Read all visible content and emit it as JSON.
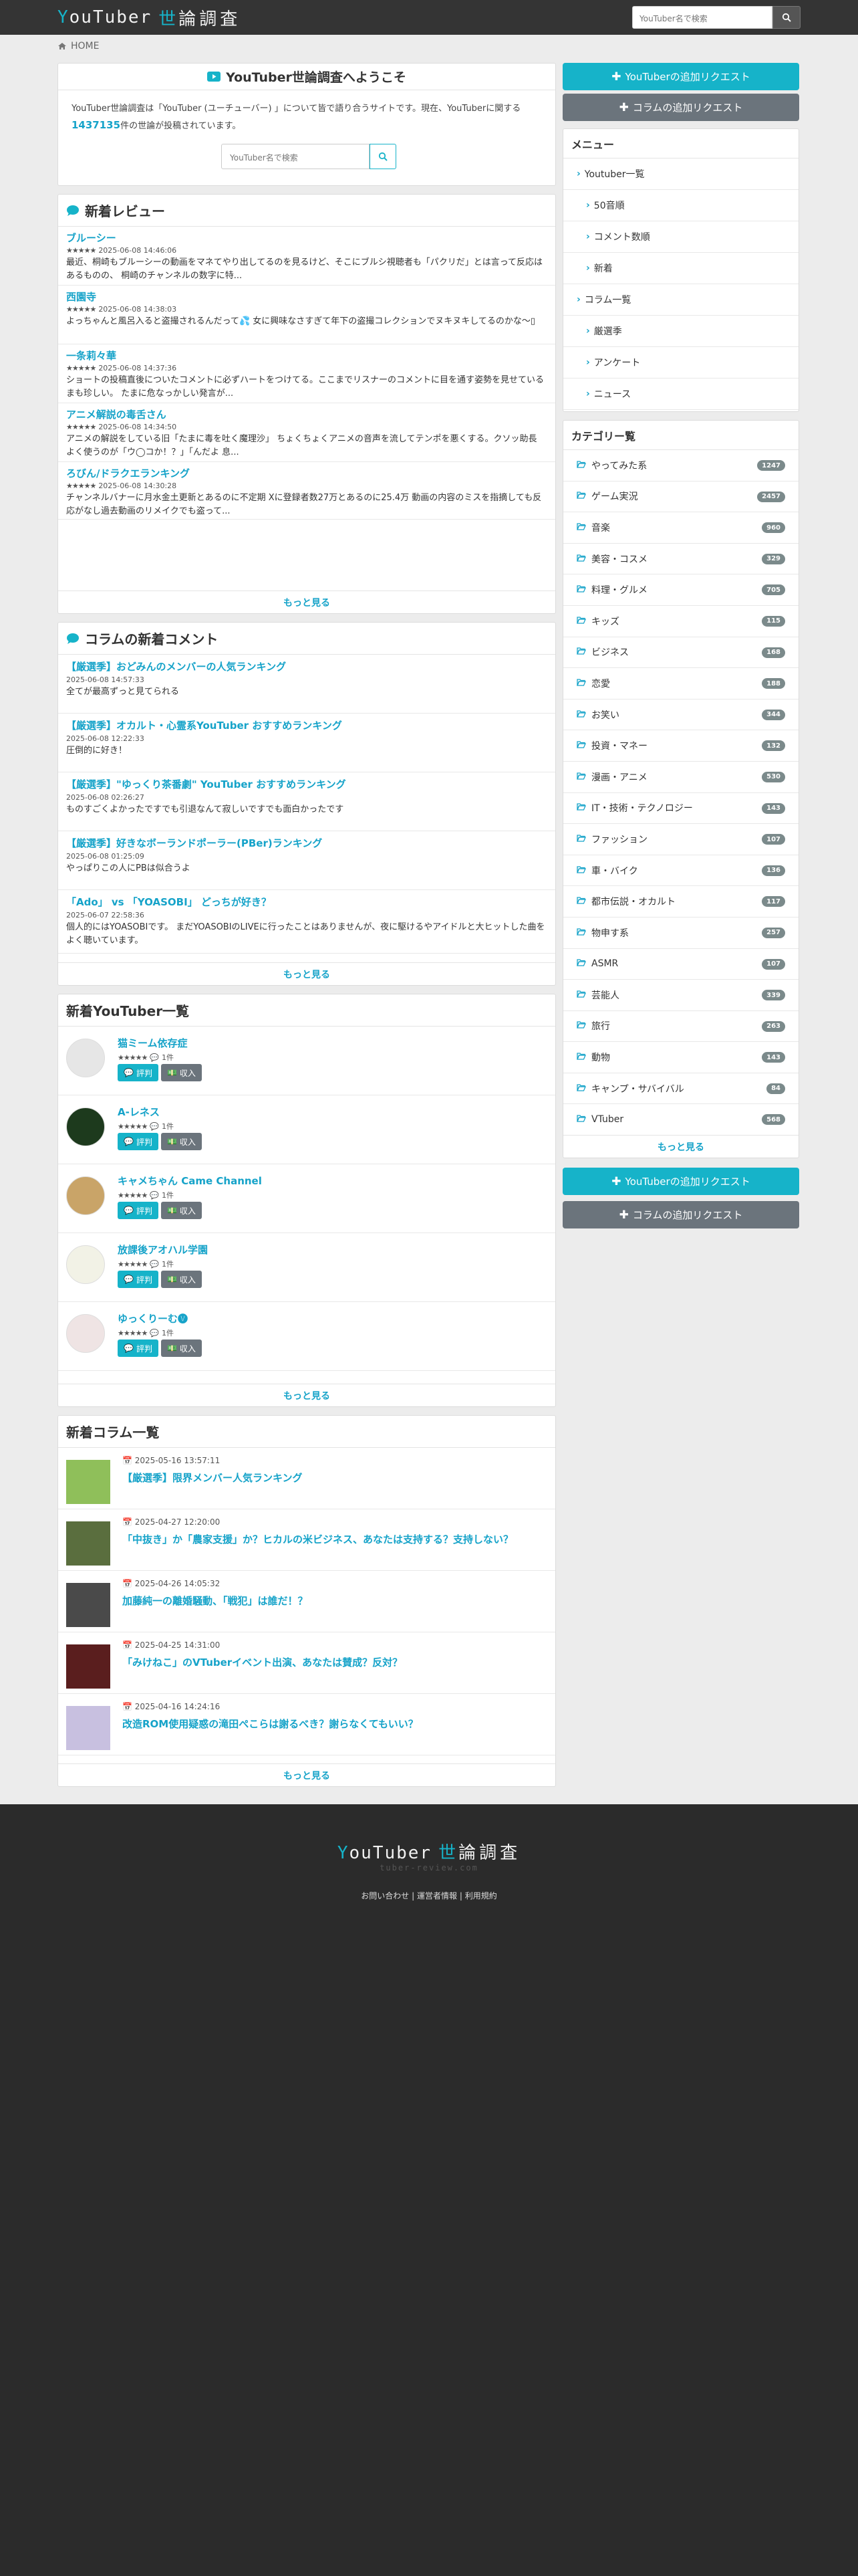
{
  "header": {
    "logo_y": "Y",
    "logo_rest": "ouTuber",
    "logo_kanji1": "世",
    "logo_kanji2": "論調査",
    "search_placeholder": "YouTuber名で検索",
    "search_icon": "search-icon"
  },
  "breadcrumb": {
    "home": "HOME"
  },
  "welcome": {
    "title": "YouTuber世論調査へようこそ",
    "text_before": "YouTuber世論調査は「YouTuber (ユーチューバー) 」について皆で語り合うサイトです。現在、YouTuberに関する",
    "count": "1437135",
    "text_after": "件の世論が投稿されています。",
    "search_placeholder": "YouTuber名で検索"
  },
  "reviews": {
    "title": "新着レビュー",
    "items": [
      {
        "name": "ブルーシー",
        "date": "2025-06-08 14:46:06",
        "body": "最近、桐崎もブルーシーの動画をマネてやり出してるのを見るけど、そこにブルシ視聴者も「パクリだ」とは言って反応はあるものの、 桐崎のチャンネルの数字に特..."
      },
      {
        "name": "西園寺",
        "date": "2025-06-08 14:38:03",
        "body": "よっちゃんと風呂入ると盗撮されるんだって💦 女に興味なさすぎて年下の盗撮コレクションでヌキヌキしてるのかな〜▯"
      },
      {
        "name": "一条莉々華",
        "date": "2025-06-08 14:37:36",
        "body": "ショートの投稿直後についたコメントに必ずハートをつけてる。ここまでリスナーのコメントに目を通す姿勢を見せているまも珍しい。 たまに危なっかしい発言が..."
      },
      {
        "name": "アニメ解説の毒舌さん",
        "date": "2025-06-08 14:34:50",
        "body": "アニメの解説をしている旧「たまに毒を吐く魔理沙」 ちょくちょくアニメの音声を流してテンポを悪くする。クソッ助長 よく使うのが「ウ◯コか！？」「んだよ 息..."
      },
      {
        "name": "ろびん/ドラクエランキング",
        "date": "2025-06-08 14:30:28",
        "body": "チャンネルバナーに月水金土更新とあるのに不定期 Xに登録者数27万とあるのに25.4万 動画の内容のミスを指摘しても反応がなし過去動画のリメイクでも盗って..."
      }
    ],
    "more": "もっと見る"
  },
  "column_comments": {
    "title": "コラムの新着コメント",
    "items": [
      {
        "title": "【厳選季】おどみんのメンバーの人気ランキング",
        "date": "2025-06-08 14:57:33",
        "body": "全てが最高ずっと見てられる"
      },
      {
        "title": "【厳選季】オカルト・心霊系YouTuber おすすめランキング",
        "date": "2025-06-08 12:22:33",
        "body": "圧倒的に好き！"
      },
      {
        "title": "【厳選季】\"ゆっくり茶番劇\" YouTuber おすすめランキング",
        "date": "2025-06-08 02:26:27",
        "body": "ものすごくよかったですでも引退なんて寂しいですでも面白かったです"
      },
      {
        "title": "【厳選季】好きなボーランドポーラー(PBer)ランキング",
        "date": "2025-06-08 01:25:09",
        "body": "やっぱりこの人にPBは似合うよ"
      },
      {
        "title": "「Ado」 vs 「YOASOBI」 どっちが好き？",
        "date": "2025-06-07 22:58:36",
        "body": "個人的にはYOASOBIです。 まだYOASOBIのLIVEに行ったことはありませんが、夜に駆けるやアイドルと大ヒットした曲をよく聴いています。"
      }
    ],
    "more": "もっと見る"
  },
  "new_youtubers": {
    "title": "新着YouTuber一覧",
    "review_label": "評判",
    "income_label": "収入",
    "items": [
      {
        "name": "猫ミーム依存症",
        "count": "1件",
        "avatar": "#e6e6e6"
      },
      {
        "name": "A-レネス",
        "count": "1件",
        "avatar": "#1d3a1d"
      },
      {
        "name": "キャメちゃん Came Channel",
        "count": "1件",
        "avatar": "#c9a468"
      },
      {
        "name": "放課後アオハル学園",
        "count": "1件",
        "avatar": "#f2f2e6"
      },
      {
        "name": "ゆっくりーむ🅥",
        "count": "1件",
        "avatar": "#efe4e4"
      }
    ],
    "more": "もっと見る"
  },
  "new_columns": {
    "title": "新着コラム一覧",
    "items": [
      {
        "date": "2025-05-16 13:57:11",
        "title": "【厳選季】限界メンバー人気ランキング",
        "thumb": "#8fbf5a"
      },
      {
        "date": "2025-04-27 12:20:00",
        "title": "「中抜き」か「農家支援」か？ヒカルの米ビジネス、あなたは支持する？支持しない？",
        "thumb": "#5a6e3e"
      },
      {
        "date": "2025-04-26 14:05:32",
        "title": "加藤純一の離婚騒動、「戦犯」は誰だ！？",
        "thumb": "#4a4a4a"
      },
      {
        "date": "2025-04-25 14:31:00",
        "title": "「みけねこ」のVTuberイベント出演、あなたは賛成？反対？",
        "thumb": "#5a1e1e"
      },
      {
        "date": "2025-04-16 14:24:16",
        "title": "改造ROM使用疑惑の滝田ぺこらは謝るべき？謝らなくてもいい？",
        "thumb": "#c8c0e0"
      }
    ],
    "more": "もっと見る"
  },
  "sidebar": {
    "add_youtuber": "YouTuberの追加リクエスト",
    "add_column": "コラムの追加リクエスト",
    "menu_title": "メニュー",
    "menu": [
      {
        "label": "Youtuber一覧",
        "level": 0
      },
      {
        "label": "50音順",
        "level": 1
      },
      {
        "label": "コメント数順",
        "level": 1
      },
      {
        "label": "新着",
        "level": 1
      },
      {
        "label": "コラム一覧",
        "level": 0
      },
      {
        "label": "厳選季",
        "level": 1
      },
      {
        "label": "アンケート",
        "level": 1
      },
      {
        "label": "ニュース",
        "level": 1
      }
    ],
    "categories_title": "カテゴリー覧",
    "categories": [
      {
        "label": "やってみた系",
        "count": "1247"
      },
      {
        "label": "ゲーム実況",
        "count": "2457"
      },
      {
        "label": "音楽",
        "count": "960"
      },
      {
        "label": "美容・コスメ",
        "count": "329"
      },
      {
        "label": "料理・グルメ",
        "count": "705"
      },
      {
        "label": "キッズ",
        "count": "115"
      },
      {
        "label": "ビジネス",
        "count": "168"
      },
      {
        "label": "恋愛",
        "count": "188"
      },
      {
        "label": "お笑い",
        "count": "344"
      },
      {
        "label": "投資・マネー",
        "count": "132"
      },
      {
        "label": "漫画・アニメ",
        "count": "530"
      },
      {
        "label": "IT・技術・テクノロジー",
        "count": "143"
      },
      {
        "label": "ファッション",
        "count": "107"
      },
      {
        "label": "車・バイク",
        "count": "136"
      },
      {
        "label": "都市伝説・オカルト",
        "count": "117"
      },
      {
        "label": "物申す系",
        "count": "257"
      },
      {
        "label": "ASMR",
        "count": "107"
      },
      {
        "label": "芸能人",
        "count": "339"
      },
      {
        "label": "旅行",
        "count": "263"
      },
      {
        "label": "動物",
        "count": "143"
      },
      {
        "label": "キャンプ・サバイバル",
        "count": "84"
      },
      {
        "label": "VTuber",
        "count": "568"
      }
    ],
    "more": "もっと見る"
  },
  "footer": {
    "sub": "tuber-review.com",
    "contact": "お問い合わせ",
    "operator": "運営者情報",
    "terms": "利用規約",
    "sep": "|"
  },
  "colors": {
    "accent": "#16b3c9",
    "link": "#16a3c9",
    "gray_button": "#6b747c",
    "header": "#343434"
  }
}
